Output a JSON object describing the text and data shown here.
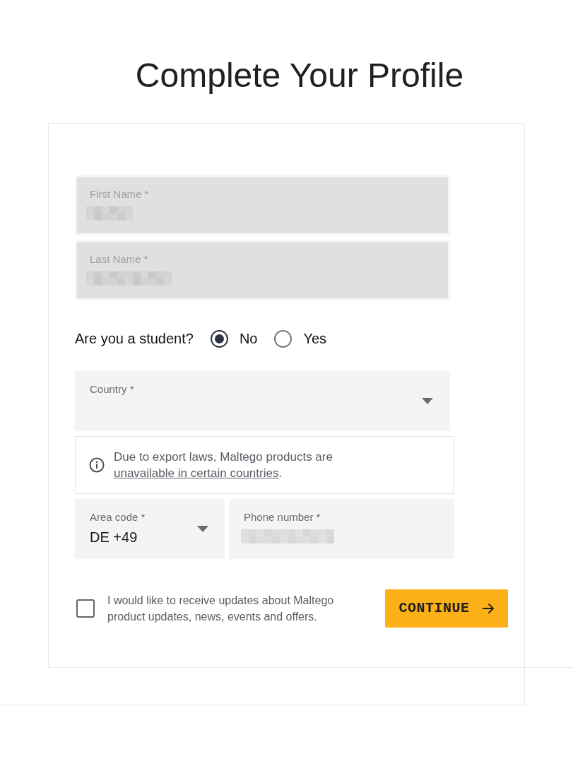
{
  "title": "Complete Your Profile",
  "fields": [
    {
      "label": "First Name *",
      "disabled": true,
      "value_hidden": true
    },
    {
      "label": "Last Name *",
      "disabled": true,
      "value_hidden": true
    }
  ],
  "student_question": {
    "label": "Are you a student?",
    "options": [
      {
        "label": "No",
        "selected": true
      },
      {
        "label": "Yes",
        "selected": false
      }
    ]
  },
  "country": {
    "label": "Country *"
  },
  "notice": {
    "text": "Due to export laws, Maltego products are",
    "link": "unavailable in certain countries",
    "after": "."
  },
  "phone": {
    "area_code": {
      "label": "Area code *",
      "value": "DE +49"
    },
    "number": {
      "label": "Phone number *",
      "value_hidden": true
    }
  },
  "newsletter": {
    "label": "I would like to receive updates about Maltego product updates, news, events and offers.",
    "checked": false
  },
  "continue_button": {
    "label": "CONTINUE"
  }
}
